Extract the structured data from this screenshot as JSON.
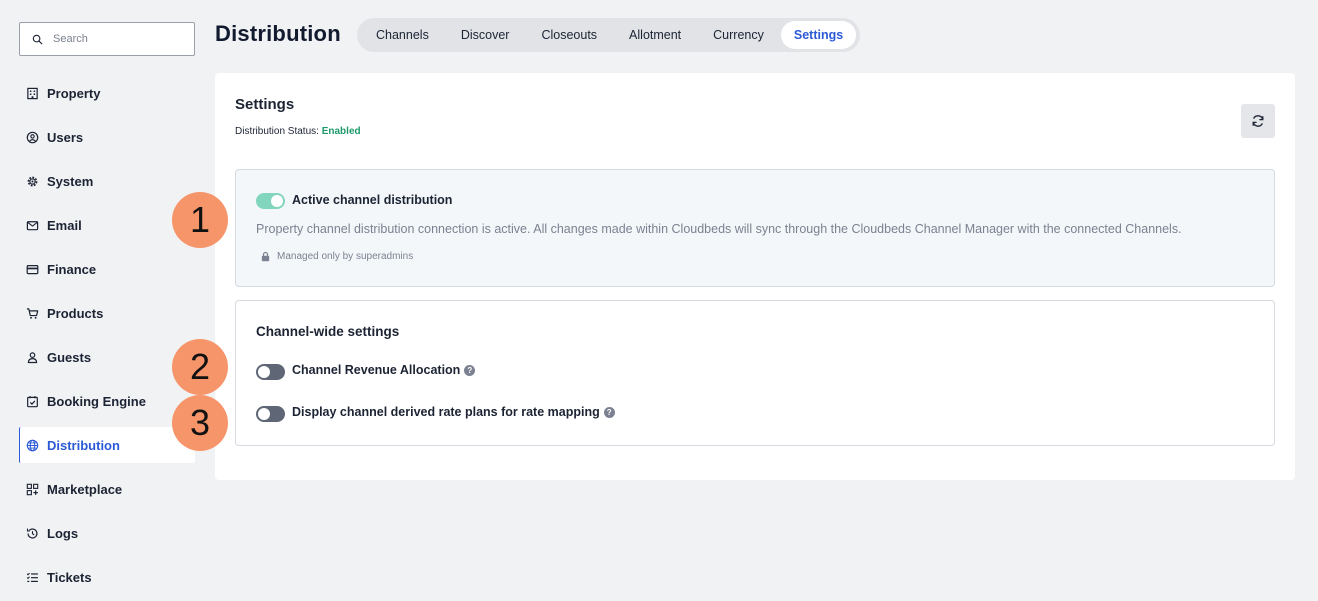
{
  "sidebar": {
    "search_placeholder": "Search",
    "items": [
      {
        "label": "Property",
        "icon": "building-icon"
      },
      {
        "label": "Users",
        "icon": "user-circle-icon"
      },
      {
        "label": "System",
        "icon": "gear-icon"
      },
      {
        "label": "Email",
        "icon": "envelope-icon"
      },
      {
        "label": "Finance",
        "icon": "credit-card-icon"
      },
      {
        "label": "Products",
        "icon": "cart-icon"
      },
      {
        "label": "Guests",
        "icon": "person-icon"
      },
      {
        "label": "Booking Engine",
        "icon": "calendar-check-icon"
      },
      {
        "label": "Distribution",
        "icon": "globe-icon",
        "active": true
      },
      {
        "label": "Marketplace",
        "icon": "apps-plus-icon"
      },
      {
        "label": "Logs",
        "icon": "history-icon"
      },
      {
        "label": "Tickets",
        "icon": "checklist-icon"
      }
    ]
  },
  "header": {
    "title": "Distribution",
    "tabs": [
      "Channels",
      "Discover",
      "Closeouts",
      "Allotment",
      "Currency",
      "Settings"
    ],
    "active_tab": "Settings"
  },
  "card": {
    "title": "Settings",
    "status_label": "Distribution Status:",
    "status_value": "Enabled",
    "refresh_icon": "refresh-icon"
  },
  "active_distribution": {
    "label": "Active channel distribution",
    "enabled": true,
    "description": "Property channel distribution connection is active. All changes made within Cloudbeds will sync through the Cloudbeds Channel Manager with the connected Channels.",
    "managed_note": "Managed only by superadmins"
  },
  "channel_settings": {
    "title": "Channel-wide settings",
    "items": [
      {
        "label": "Channel Revenue Allocation",
        "enabled": false
      },
      {
        "label": "Display channel derived rate plans for rate mapping",
        "enabled": false
      }
    ]
  },
  "annotations": [
    "1",
    "2",
    "3"
  ],
  "colors": {
    "accent": "#2c5ad6",
    "status_enabled": "#1f9a6a",
    "toggle_on": "#82d6bd",
    "toggle_off": "#5f6676",
    "annotation_badge": "#f6956a"
  }
}
